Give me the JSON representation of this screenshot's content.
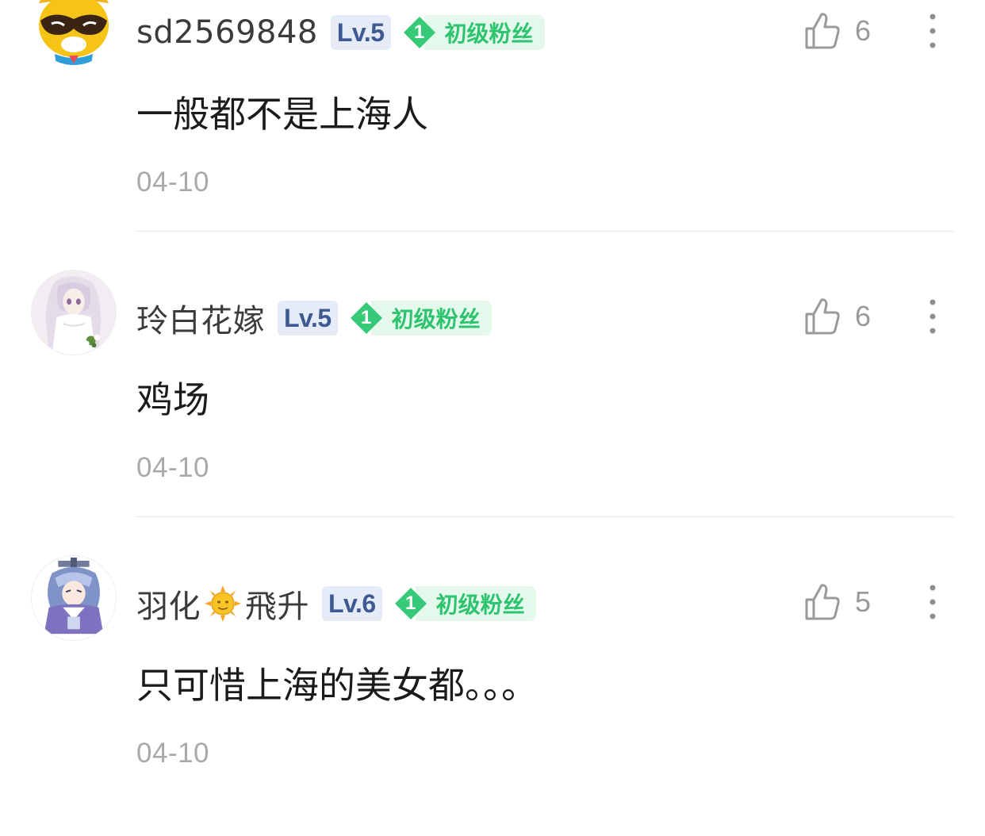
{
  "comments": [
    {
      "username": "sd2569848",
      "level": "Lv.5",
      "fan_level": "1",
      "fan_label": "初级粉丝",
      "likes": "6",
      "text": "一般都不是上海人",
      "date": "04-10",
      "avatar": "raccoon-avatar"
    },
    {
      "username": "玲白花嫁",
      "level": "Lv.5",
      "fan_level": "1",
      "fan_label": "初级粉丝",
      "likes": "6",
      "text": "鸡场",
      "date": "04-10",
      "avatar": "bride-avatar"
    },
    {
      "username_part1": "羽化",
      "username_emoji": "sun-emoji",
      "username_part2": "飛升",
      "level": "Lv.6",
      "fan_level": "1",
      "fan_label": "初级粉丝",
      "likes": "5",
      "text": "只可惜上海的美女都。。。",
      "date": "04-10",
      "avatar": "swordsman-avatar"
    }
  ],
  "colors": {
    "level_badge_bg": "#e5ebf7",
    "level_badge_text": "#3f5a92",
    "fan_badge_green": "#2ec36e",
    "fan_badge_bg": "#e4f8ec",
    "meta_gray": "#a9a9a9"
  }
}
